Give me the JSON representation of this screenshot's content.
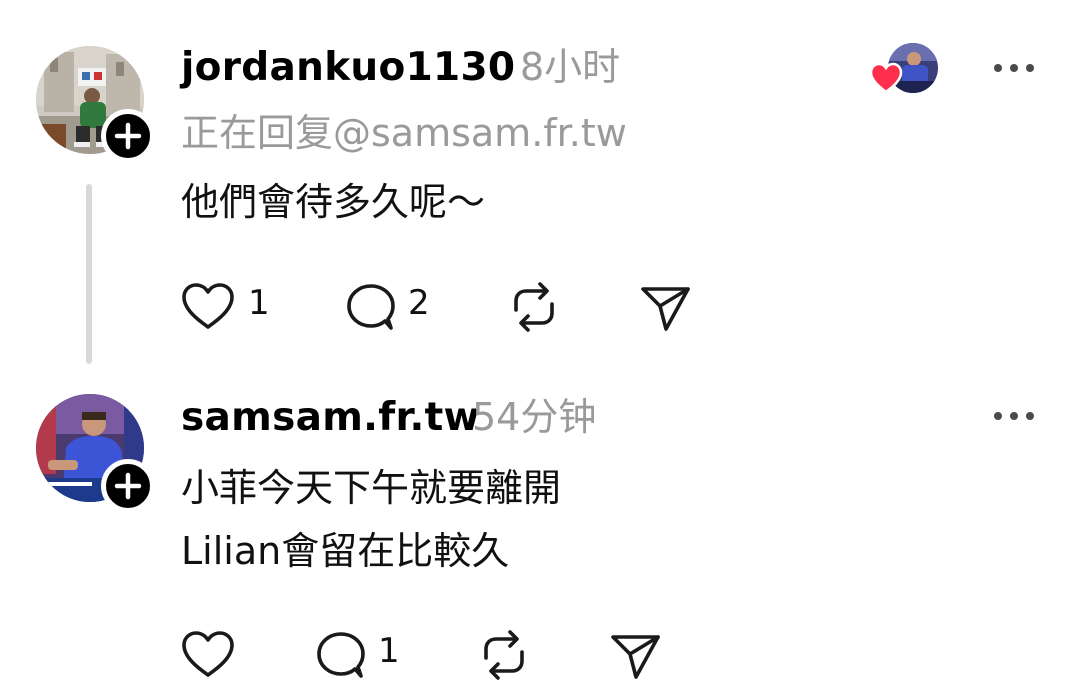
{
  "posts": [
    {
      "username": "jordankuo1130",
      "time": "8小时",
      "reply_to": "正在回复@samsam.fr.tw",
      "lines": [
        "他們會待多久呢～"
      ],
      "likes": "1",
      "replies": "2"
    },
    {
      "username": "samsam.fr.tw",
      "time": "54分钟",
      "lines": [
        "小菲今天下午就要離開",
        "Lilian會留在比較久"
      ],
      "likes": "",
      "replies": "1"
    }
  ],
  "icons": {
    "like": "heart-outline-icon",
    "comment": "speech-bubble-icon",
    "repost": "repost-arrows-icon",
    "share": "paper-plane-icon",
    "more": "ellipsis-icon",
    "follow": "plus-icon",
    "liked_by_author": "red-heart-icon"
  },
  "colors": {
    "text": "#111111",
    "muted": "#9a9a9a",
    "thread_line": "#d9d9d9",
    "heart_red": "#ff2e4d",
    "badge": "#000000"
  }
}
